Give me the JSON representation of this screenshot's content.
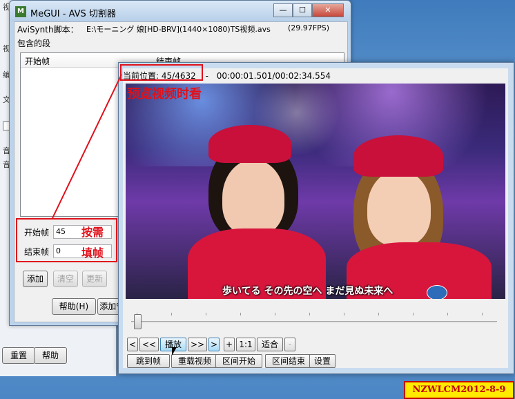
{
  "background_window": {
    "side_fragments": [
      "视频",
      "视",
      "编",
      "文",
      "音",
      "音"
    ],
    "reset_label": "重置",
    "help_label": "帮助"
  },
  "megui": {
    "title": "MeGUI - AVS 切割器",
    "script_label": "AviSynth脚本：",
    "script_path": "E:\\モーニング 娘[HD-BRV](1440×1080)TS视频.avs",
    "fps": "(29.97FPS)",
    "segments_label": "包含的段",
    "col_start": "开始帧",
    "col_end": "结束帧",
    "start_label": "开始帧",
    "start_value": "45",
    "end_label": "结束帧",
    "end_value": "0",
    "buttons": {
      "add": "添加",
      "clear": "清空",
      "update": "更新",
      "help": "帮助(H)",
      "add_to": "添加%"
    },
    "window_controls": {
      "minimize": "—",
      "maximize": "☐",
      "close": "✕"
    }
  },
  "preview": {
    "position_label": "当前位置:",
    "position_value": "45/4632",
    "separator": "-",
    "time_value": "00:00:01.501/00:02:34.554",
    "subtitle": "歩いてる その先の空へ まだ見ぬ未来へ",
    "controls": {
      "prev": "<",
      "rewind": "<<",
      "play": "播放",
      "forward": ">>",
      "next": ">",
      "zoom_in": "+",
      "one_to_one": "1:1",
      "fit": "适合",
      "zoom_out": "-"
    },
    "bottom_buttons": {
      "goto": "跳到帧",
      "reload": "重载视频",
      "zone_start": "区间开始",
      "zone_end": "区间结束",
      "settings": "设置"
    }
  },
  "annotations": {
    "preview_note": "预览视频时看",
    "as_needed": "按需",
    "fill_frame": "填帧",
    "stamp": "NZWLCM2012-8-9"
  },
  "colors": {
    "annotation_red": "#e0101a",
    "stamp_yellow": "#ffeb00"
  }
}
